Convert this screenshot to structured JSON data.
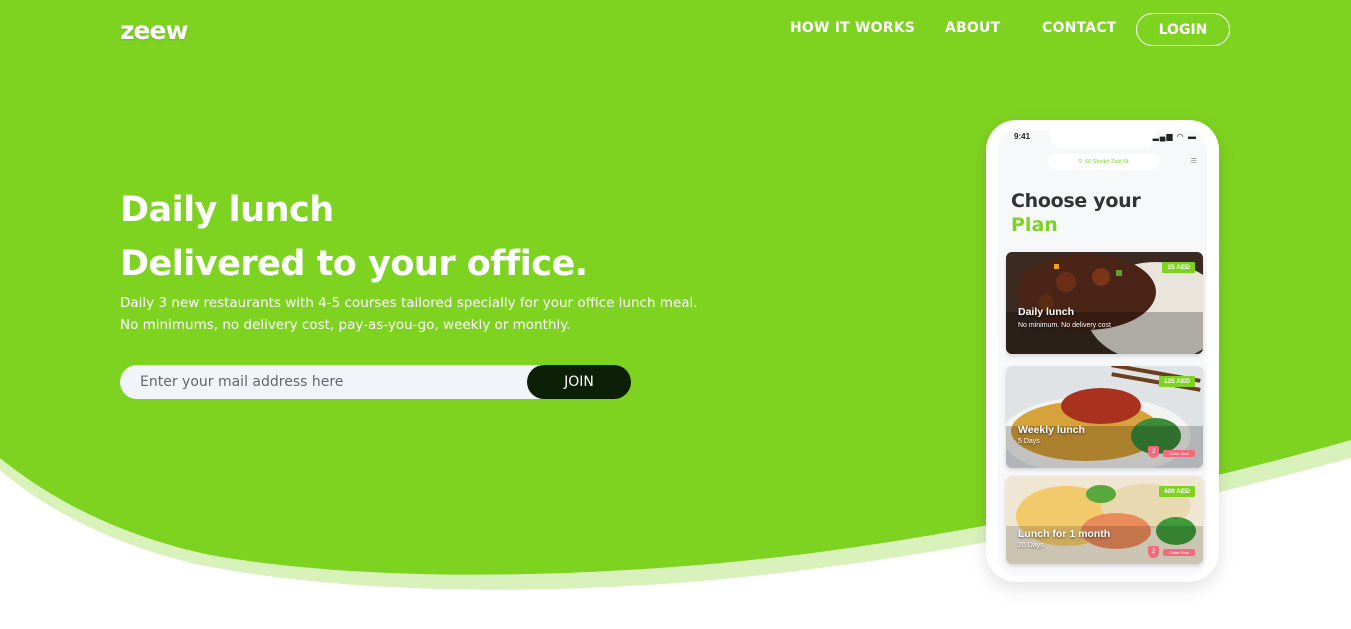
{
  "brand": {
    "logo": "zeew",
    "accent_color": "#7ed321",
    "dark_color": "#0c1f07"
  },
  "nav": {
    "how_it_works": "HOW IT WORKS",
    "about": "ABOUT",
    "contact": "CONTACT",
    "login": "LOGIN"
  },
  "hero": {
    "headline_line1": "Daily lunch",
    "headline_line2": "Delivered to your office.",
    "subtitle_line1": "Daily 3 new restaurants with 4-5 courses tailored specially for your office lunch meal.",
    "subtitle_line2": "No minimums, no delivery cost, pay-as-you-go, weekly or monthly."
  },
  "signup": {
    "placeholder": "Enter your mail address here",
    "value": "",
    "join_label": "JOIN"
  },
  "phone": {
    "time": "9:41",
    "status_icons": "signal-wifi-battery",
    "location": "66 Sheikh Zaid St.",
    "title_line1": "Choose your",
    "title_line2": "Plan",
    "plans": [
      {
        "name": "Daily lunch",
        "meta": "No minimum. No delivery cost",
        "price": "25 AED"
      },
      {
        "name": "Weekly lunch",
        "meta": "5 Days",
        "price": "125 AED",
        "badge": "2",
        "order_label": "Order Now"
      },
      {
        "name": "Lunch for 1 month",
        "meta": "20 Days",
        "price": "400 AED",
        "badge": "2",
        "order_label": "Order Now"
      }
    ]
  }
}
